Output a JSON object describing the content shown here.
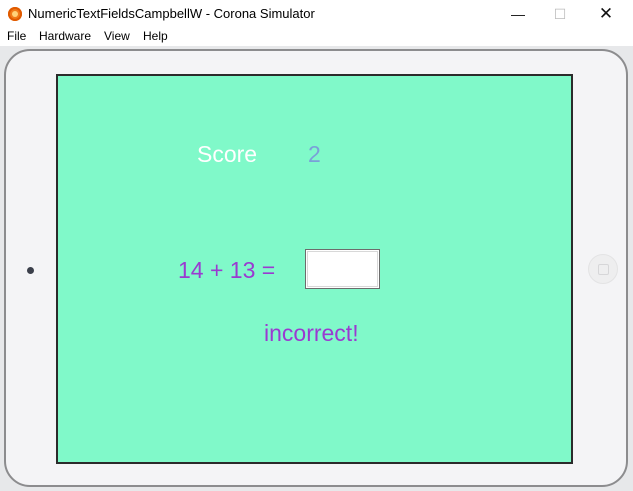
{
  "window": {
    "title": "NumericTextFieldsCampbellW - Corona Simulator",
    "minimize_glyph": "—",
    "maximize_glyph": "☐",
    "close_glyph": "✕"
  },
  "menu": {
    "items": [
      "File",
      "Hardware",
      "View",
      "Help"
    ]
  },
  "game": {
    "score_label": "Score",
    "score_value": "2",
    "question": "14 + 13 =",
    "answer_value": "",
    "feedback": "incorrect!"
  },
  "colors": {
    "screen_background": "#80f9c9",
    "question_text": "#9a3ad1",
    "score_label_text": "#ffffff",
    "score_value_text": "#7aa0d8"
  },
  "icons": {
    "app": "corona-app-icon",
    "camera": "camera-dot-icon",
    "home": "home-button-icon"
  }
}
